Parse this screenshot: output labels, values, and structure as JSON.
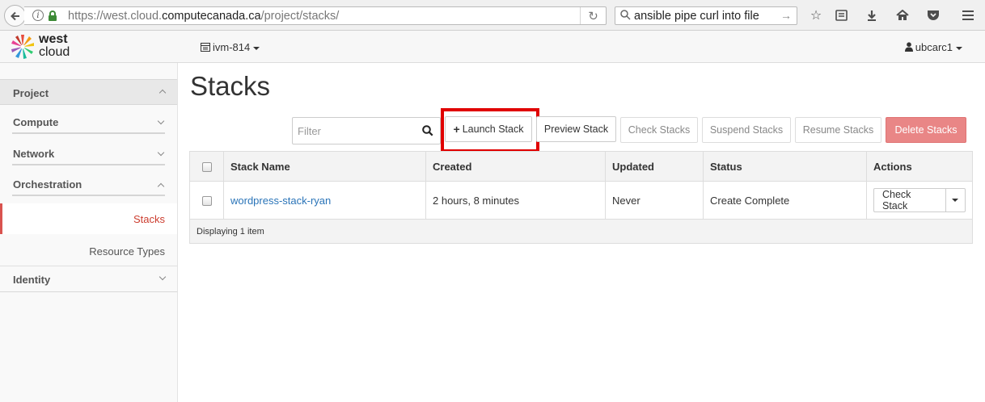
{
  "browser": {
    "url_prefix": "https://west.cloud.",
    "url_host": "computecanada.ca",
    "url_path": "/project/stacks/",
    "search_query": "ansible pipe curl into file"
  },
  "topnav": {
    "brand_line1": "west",
    "brand_line2": "cloud",
    "project_selector": "ivm-814",
    "user_menu": "ubcarc1"
  },
  "sidebar": {
    "project": "Project",
    "compute": "Compute",
    "network": "Network",
    "orchestration": "Orchestration",
    "stacks": "Stacks",
    "resource_types": "Resource Types",
    "identity": "Identity"
  },
  "main": {
    "title": "Stacks",
    "filter_placeholder": "Filter",
    "buttons": {
      "launch": "Launch Stack",
      "preview": "Preview Stack",
      "check": "Check Stacks",
      "suspend": "Suspend Stacks",
      "resume": "Resume Stacks",
      "delete": "Delete Stacks"
    },
    "table": {
      "headers": [
        "Stack Name",
        "Created",
        "Updated",
        "Status",
        "Actions"
      ],
      "rows": [
        {
          "name": "wordpress-stack-ryan",
          "created": "2 hours, 8 minutes",
          "updated": "Never",
          "status": "Create Complete",
          "action": "Check Stack"
        }
      ],
      "footer": "Displaying 1 item"
    }
  },
  "colors": {
    "accent_red": "#cc3d2f",
    "delete_button": "#e98686",
    "link_blue": "#2a74b8",
    "highlight_box": "#e00000"
  }
}
